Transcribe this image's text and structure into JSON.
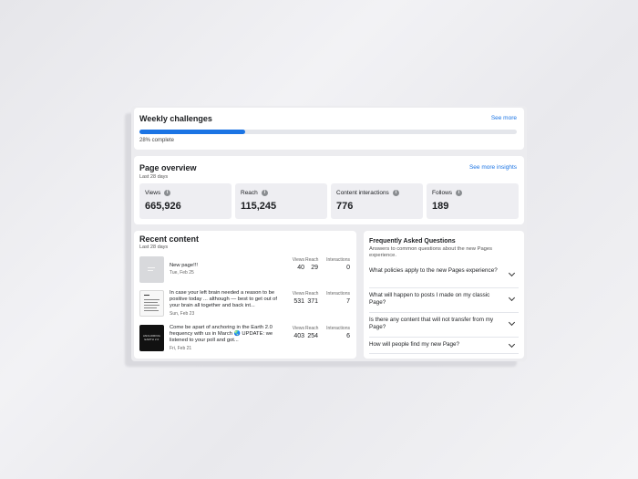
{
  "weekly_challenges": {
    "title": "Weekly challenges",
    "see_more": "See more",
    "progress": 0.28,
    "progress_label": "28% complete",
    "accent": "#1b74e4"
  },
  "page_overview": {
    "title": "Page overview",
    "subtitle": "Last 28 days",
    "see_more": "See more insights",
    "stats": [
      {
        "label": "Views",
        "value": "665,926"
      },
      {
        "label": "Reach",
        "value": "115,245"
      },
      {
        "label": "Content interactions",
        "value": "776"
      },
      {
        "label": "Follows",
        "value": "189"
      }
    ]
  },
  "recent_content": {
    "title": "Recent content",
    "subtitle": "Last 28 days",
    "metric_labels": {
      "views": "Views",
      "reach": "Reach",
      "interactions": "Interactions"
    },
    "posts": [
      {
        "text": "New page!!!",
        "date": "Tue, Feb 25",
        "views": "40",
        "reach": "29",
        "interactions": "0",
        "thumb": "gray"
      },
      {
        "text": "In case your left brain needed a reason to be positive today ... although — best to get out of your brain all together and back int...",
        "date": "Sun, Feb 23",
        "views": "531",
        "reach": "371",
        "interactions": "7",
        "thumb": "document"
      },
      {
        "text": "Come be apart of anchoring in the Earth 2.0 frequency with us in March 🌏 UPDATE: we listened to your poll and got...",
        "date": "Fri, Feb 21",
        "views": "403",
        "reach": "254",
        "interactions": "6",
        "thumb": "dark",
        "thumb_text": "ANCHORING EARTH 2.0"
      }
    ]
  },
  "faq": {
    "title": "Frequently Asked Questions",
    "subtitle": "Answers to common questions about the new Pages experience.",
    "questions": [
      "What policies apply to the new Pages experience?",
      "What will happen to posts I made on my classic Page?",
      "Is there any content that will not transfer from my Page?",
      "How will people find my new Page?"
    ],
    "icon": "chevron-down-icon"
  }
}
